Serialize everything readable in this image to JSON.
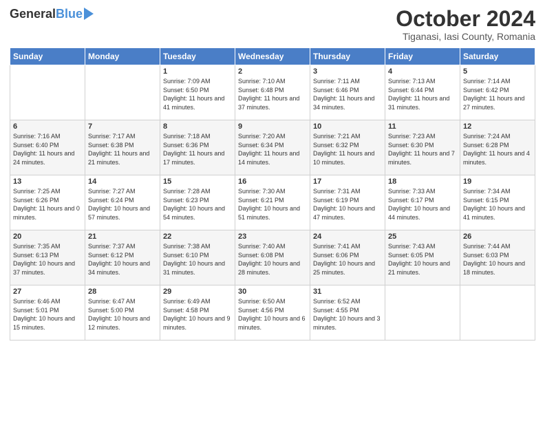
{
  "header": {
    "logo_general": "General",
    "logo_blue": "Blue",
    "month_title": "October 2024",
    "location": "Tiganasi, Iasi County, Romania"
  },
  "days_of_week": [
    "Sunday",
    "Monday",
    "Tuesday",
    "Wednesday",
    "Thursday",
    "Friday",
    "Saturday"
  ],
  "weeks": [
    [
      {
        "day": "",
        "info": ""
      },
      {
        "day": "",
        "info": ""
      },
      {
        "day": "1",
        "info": "Sunrise: 7:09 AM\nSunset: 6:50 PM\nDaylight: 11 hours and 41 minutes."
      },
      {
        "day": "2",
        "info": "Sunrise: 7:10 AM\nSunset: 6:48 PM\nDaylight: 11 hours and 37 minutes."
      },
      {
        "day": "3",
        "info": "Sunrise: 7:11 AM\nSunset: 6:46 PM\nDaylight: 11 hours and 34 minutes."
      },
      {
        "day": "4",
        "info": "Sunrise: 7:13 AM\nSunset: 6:44 PM\nDaylight: 11 hours and 31 minutes."
      },
      {
        "day": "5",
        "info": "Sunrise: 7:14 AM\nSunset: 6:42 PM\nDaylight: 11 hours and 27 minutes."
      }
    ],
    [
      {
        "day": "6",
        "info": "Sunrise: 7:16 AM\nSunset: 6:40 PM\nDaylight: 11 hours and 24 minutes."
      },
      {
        "day": "7",
        "info": "Sunrise: 7:17 AM\nSunset: 6:38 PM\nDaylight: 11 hours and 21 minutes."
      },
      {
        "day": "8",
        "info": "Sunrise: 7:18 AM\nSunset: 6:36 PM\nDaylight: 11 hours and 17 minutes."
      },
      {
        "day": "9",
        "info": "Sunrise: 7:20 AM\nSunset: 6:34 PM\nDaylight: 11 hours and 14 minutes."
      },
      {
        "day": "10",
        "info": "Sunrise: 7:21 AM\nSunset: 6:32 PM\nDaylight: 11 hours and 10 minutes."
      },
      {
        "day": "11",
        "info": "Sunrise: 7:23 AM\nSunset: 6:30 PM\nDaylight: 11 hours and 7 minutes."
      },
      {
        "day": "12",
        "info": "Sunrise: 7:24 AM\nSunset: 6:28 PM\nDaylight: 11 hours and 4 minutes."
      }
    ],
    [
      {
        "day": "13",
        "info": "Sunrise: 7:25 AM\nSunset: 6:26 PM\nDaylight: 11 hours and 0 minutes."
      },
      {
        "day": "14",
        "info": "Sunrise: 7:27 AM\nSunset: 6:24 PM\nDaylight: 10 hours and 57 minutes."
      },
      {
        "day": "15",
        "info": "Sunrise: 7:28 AM\nSunset: 6:23 PM\nDaylight: 10 hours and 54 minutes."
      },
      {
        "day": "16",
        "info": "Sunrise: 7:30 AM\nSunset: 6:21 PM\nDaylight: 10 hours and 51 minutes."
      },
      {
        "day": "17",
        "info": "Sunrise: 7:31 AM\nSunset: 6:19 PM\nDaylight: 10 hours and 47 minutes."
      },
      {
        "day": "18",
        "info": "Sunrise: 7:33 AM\nSunset: 6:17 PM\nDaylight: 10 hours and 44 minutes."
      },
      {
        "day": "19",
        "info": "Sunrise: 7:34 AM\nSunset: 6:15 PM\nDaylight: 10 hours and 41 minutes."
      }
    ],
    [
      {
        "day": "20",
        "info": "Sunrise: 7:35 AM\nSunset: 6:13 PM\nDaylight: 10 hours and 37 minutes."
      },
      {
        "day": "21",
        "info": "Sunrise: 7:37 AM\nSunset: 6:12 PM\nDaylight: 10 hours and 34 minutes."
      },
      {
        "day": "22",
        "info": "Sunrise: 7:38 AM\nSunset: 6:10 PM\nDaylight: 10 hours and 31 minutes."
      },
      {
        "day": "23",
        "info": "Sunrise: 7:40 AM\nSunset: 6:08 PM\nDaylight: 10 hours and 28 minutes."
      },
      {
        "day": "24",
        "info": "Sunrise: 7:41 AM\nSunset: 6:06 PM\nDaylight: 10 hours and 25 minutes."
      },
      {
        "day": "25",
        "info": "Sunrise: 7:43 AM\nSunset: 6:05 PM\nDaylight: 10 hours and 21 minutes."
      },
      {
        "day": "26",
        "info": "Sunrise: 7:44 AM\nSunset: 6:03 PM\nDaylight: 10 hours and 18 minutes."
      }
    ],
    [
      {
        "day": "27",
        "info": "Sunrise: 6:46 AM\nSunset: 5:01 PM\nDaylight: 10 hours and 15 minutes."
      },
      {
        "day": "28",
        "info": "Sunrise: 6:47 AM\nSunset: 5:00 PM\nDaylight: 10 hours and 12 minutes."
      },
      {
        "day": "29",
        "info": "Sunrise: 6:49 AM\nSunset: 4:58 PM\nDaylight: 10 hours and 9 minutes."
      },
      {
        "day": "30",
        "info": "Sunrise: 6:50 AM\nSunset: 4:56 PM\nDaylight: 10 hours and 6 minutes."
      },
      {
        "day": "31",
        "info": "Sunrise: 6:52 AM\nSunset: 4:55 PM\nDaylight: 10 hours and 3 minutes."
      },
      {
        "day": "",
        "info": ""
      },
      {
        "day": "",
        "info": ""
      }
    ]
  ]
}
